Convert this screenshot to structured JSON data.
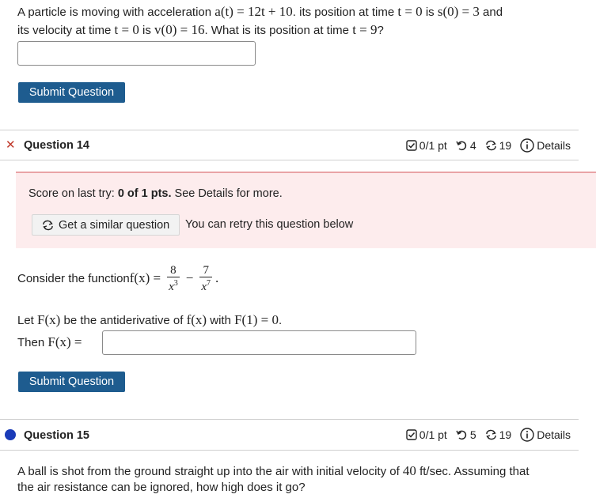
{
  "q13": {
    "line1": {
      "t1": "A particle is moving with acceleration ",
      "m1": "a(t) = 12t + 10",
      "t2": ". its position at time ",
      "m2": "t = 0",
      "t3": " is ",
      "m3": "s(0) = 3",
      "t4": " and"
    },
    "line2": {
      "t1": "its velocity at time ",
      "m1": "t = 0",
      "t2": " is ",
      "m2": "v(0) = 16",
      "t3": ". What is its position at time ",
      "m3": "t = 9",
      "t4": "?"
    },
    "answer_value": "",
    "submit_label": "Submit Question"
  },
  "q14": {
    "title": "Question 14",
    "status_mark": "✕",
    "score": "0/1 pt",
    "tries": "4",
    "regens": "19",
    "details_label": "Details",
    "feedback": {
      "prefix": "Score on last try: ",
      "score_bold": "0 of 1 pts.",
      "suffix": " See Details for more.",
      "similar_label": "Get a similar question",
      "retry_text": "You can retry this question below"
    },
    "function_line": {
      "t1": "Consider the function ",
      "lhs": "f(x) =",
      "frac1_num": "8",
      "frac1_den": "x",
      "frac1_exp": "3",
      "minus": "−",
      "frac2_num": "7",
      "frac2_den": "x",
      "frac2_exp": "7",
      "end": "."
    },
    "antideriv_line": {
      "t1": "Let ",
      "m1": "F(x)",
      "t2": " be the antiderivative of ",
      "m2": "f(x)",
      "t3": " with ",
      "m3": "F(1) = 0",
      "t4": "."
    },
    "then_line": {
      "t1": "Then ",
      "m1": "F(x) ="
    },
    "answer_value": "",
    "submit_label": "Submit Question"
  },
  "q15": {
    "title": "Question 15",
    "score": "0/1 pt",
    "tries": "5",
    "regens": "19",
    "details_label": "Details",
    "line1": {
      "t1": "A ball is shot from the ground straight up into the air with initial velocity of ",
      "m1": "40",
      "t2": " ft/sec. Assuming that"
    },
    "line2": "the air resistance can be ignored, how high does it go?"
  },
  "colors": {
    "submit_bg": "#1e5c8f",
    "error_red": "#c0392b",
    "feedback_bg": "#fdeced",
    "active_dot": "#1a3bb8"
  }
}
